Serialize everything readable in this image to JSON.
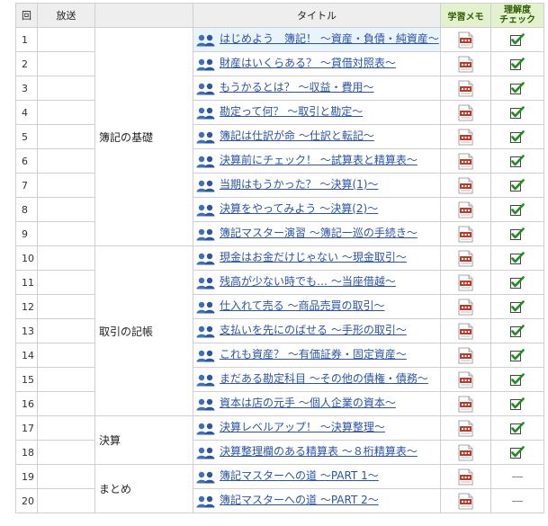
{
  "header": {
    "num": "回",
    "broadcast": "放送",
    "group": "",
    "title": "タイトル",
    "memo": "学習メモ",
    "check_line1": "理解度",
    "check_line2": "チェック"
  },
  "groups": [
    {
      "label": "簿記の基礎",
      "start": 0,
      "span": 9
    },
    {
      "label": "取引の記帳",
      "start": 9,
      "span": 7
    },
    {
      "label": "決算",
      "start": 16,
      "span": 2
    },
    {
      "label": "まとめ",
      "start": 18,
      "span": 2
    }
  ],
  "rows": [
    {
      "num": "1",
      "title": "はじめよう　簿記！ ～資産・負債・純資産～",
      "checked": true,
      "highlight": true
    },
    {
      "num": "2",
      "title": "財産はいくらある？ ～貸借対照表～",
      "checked": true
    },
    {
      "num": "3",
      "title": "もうかるとは？ ～収益・費用～",
      "checked": true
    },
    {
      "num": "4",
      "title": "勘定って何？ ～取引と勘定～",
      "checked": true
    },
    {
      "num": "5",
      "title": "簿記は仕訳が命 ～仕訳と転記～",
      "checked": true
    },
    {
      "num": "6",
      "title": "決算前にチェック！ ～試算表と精算表～",
      "checked": true
    },
    {
      "num": "7",
      "title": "当期はもうかった？ ～決算(1)～",
      "checked": true
    },
    {
      "num": "8",
      "title": "決算をやってみよう ～決算(2)～",
      "checked": true
    },
    {
      "num": "9",
      "title": "簿記マスター演習 ～簿記一巡の手続き～",
      "checked": true
    },
    {
      "num": "10",
      "title": "現金はお金だけじゃない ～現金取引～",
      "checked": true
    },
    {
      "num": "11",
      "title": "残高が少ない時でも… ～当座借越～",
      "checked": true
    },
    {
      "num": "12",
      "title": "仕入れて売る ～商品売買の取引～",
      "checked": true
    },
    {
      "num": "13",
      "title": "支払いを先にのばせる ～手形の取引～",
      "checked": true
    },
    {
      "num": "14",
      "title": "これも資産？ ～有価証券・固定資産～",
      "checked": true
    },
    {
      "num": "15",
      "title": "まだある勘定科目 ～その他の債権・債務～",
      "checked": true
    },
    {
      "num": "16",
      "title": "資本は店の元手 ～個人企業の資本～",
      "checked": true
    },
    {
      "num": "17",
      "title": "決算レベルアップ！ ～決算整理～",
      "checked": true
    },
    {
      "num": "18",
      "title": "決算整理欄のある精算表 ～８桁精算表～",
      "checked": true
    },
    {
      "num": "19",
      "title": "簿記マスターへの道 ～PART 1～",
      "checked": false
    },
    {
      "num": "20",
      "title": "簿記マスターへの道 ～PART 2～",
      "checked": false
    }
  ],
  "icons": {
    "title": "people-icon",
    "memo": "pdf-icon",
    "checked": "checkmark-icon",
    "unchecked": "dash"
  },
  "colors": {
    "link": "#2a55a8",
    "header_bg": "#eeeeee",
    "memo_header_bg": "#e4f1cf",
    "check_green": "#1e8f1e",
    "pdf_red": "#c0392b",
    "highlight_row": "#e8f3fc"
  }
}
